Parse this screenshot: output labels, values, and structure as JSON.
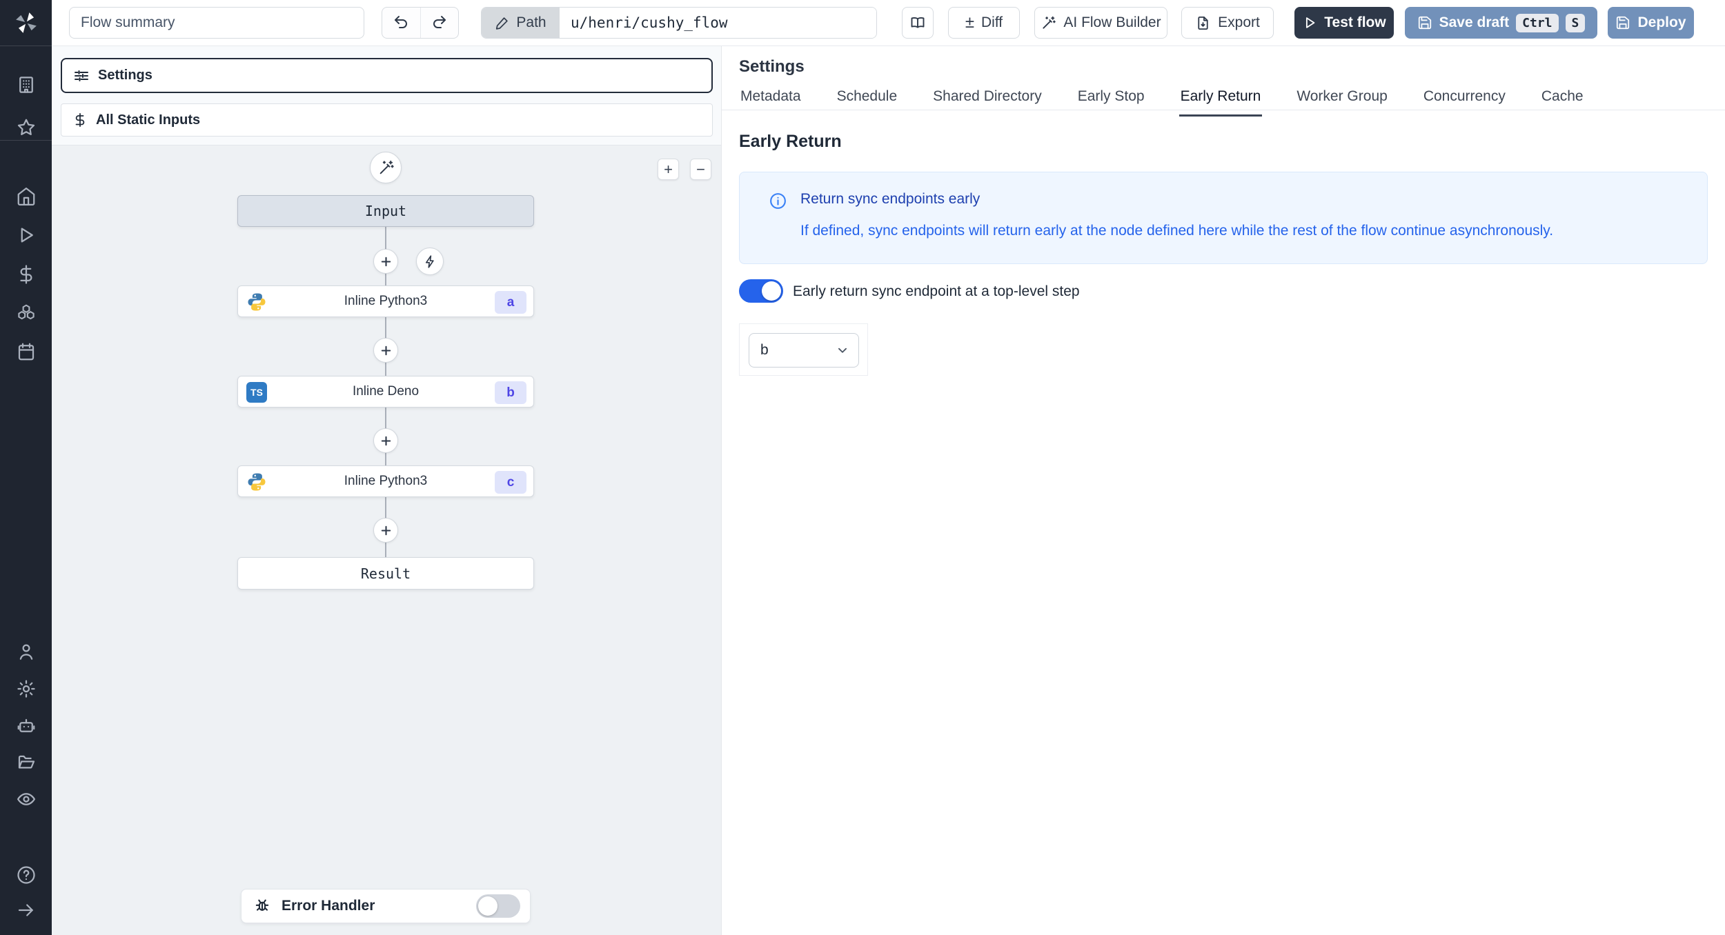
{
  "topbar": {
    "flow_summary_value": "Flow summary",
    "path_label": "Path",
    "path_value": "u/henri/cushy_flow",
    "diff_icon": "±",
    "diff_label": "Diff",
    "ai_flow_builder_label": "AI Flow Builder",
    "export_label": "Export",
    "test_flow_label": "Test flow",
    "save_draft_label": "Save draft",
    "kbd_ctrl": "Ctrl",
    "kbd_s": "S",
    "deploy_label": "Deploy"
  },
  "sidebar": {
    "icons": [
      "windmill-logo",
      "building",
      "star",
      "home",
      "run",
      "dollar",
      "resources",
      "schedules",
      "user",
      "settings-gear",
      "robot",
      "folder",
      "eye",
      "help",
      "collapse-arrow"
    ]
  },
  "left_panel": {
    "settings_label": "Settings",
    "all_static_inputs_label": "All Static Inputs"
  },
  "graph": {
    "zoom_in": "+",
    "zoom_out": "−",
    "nodes": [
      {
        "id": "input",
        "label": "Input",
        "type": "input"
      },
      {
        "id": "a",
        "label": "Inline Python3",
        "badge": "a",
        "lang": "python3"
      },
      {
        "id": "b",
        "label": "Inline Deno",
        "badge": "b",
        "lang": "deno"
      },
      {
        "id": "c",
        "label": "Inline Python3",
        "badge": "c",
        "lang": "python3"
      },
      {
        "id": "result",
        "label": "Result",
        "type": "result"
      }
    ],
    "error_handler_label": "Error Handler",
    "error_handler_enabled": false
  },
  "settings_panel": {
    "title": "Settings",
    "tabs": [
      {
        "label": "Metadata",
        "active": false
      },
      {
        "label": "Schedule",
        "active": false
      },
      {
        "label": "Shared Directory",
        "active": false
      },
      {
        "label": "Early Stop",
        "active": false
      },
      {
        "label": "Early Return",
        "active": true
      },
      {
        "label": "Worker Group",
        "active": false
      },
      {
        "label": "Concurrency",
        "active": false
      },
      {
        "label": "Cache",
        "active": false
      }
    ],
    "section_title": "Early Return",
    "info_title": "Return sync endpoints early",
    "info_body": "If defined, sync endpoints will return early at the node defined here while the rest of the flow continue asynchronously.",
    "toggle_label": "Early return sync endpoint at a top-level step",
    "toggle_enabled": true,
    "step_select_value": "b"
  },
  "colors": {
    "accent_blue": "#2563eb",
    "steel_blue": "#7291ba",
    "dark_navy": "#2e3848",
    "sidebar_bg": "#1f2530",
    "info_bg": "#eff6ff",
    "info_text": "#2563eb",
    "badge_bg": "#e0e4fb",
    "badge_text": "#4f46e5"
  }
}
